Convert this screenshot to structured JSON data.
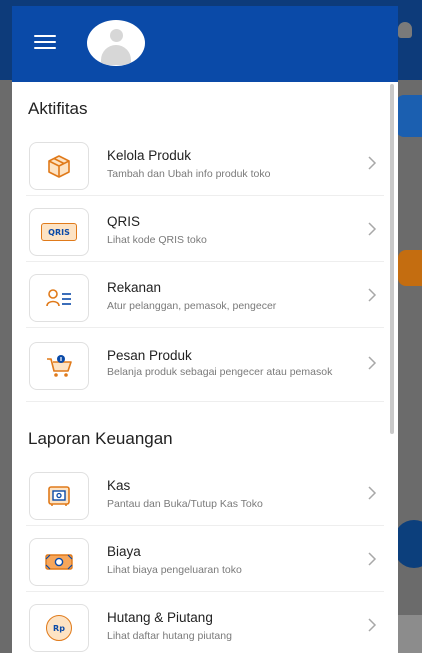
{
  "colors": {
    "header_bg": "#0a4aa8",
    "accent_orange": "#e07a1a",
    "text_primary": "#222222",
    "text_secondary": "#7a7a7a"
  },
  "header": {
    "menu_icon": "hamburger-menu-icon",
    "avatar": "user-avatar"
  },
  "sections": [
    {
      "title": "Aktifitas",
      "items": [
        {
          "title": "Kelola Produk",
          "subtitle": "Tambah dan Ubah info produk toko",
          "icon": "box-icon"
        },
        {
          "title": "QRIS",
          "subtitle": "Lihat kode QRIS toko",
          "icon": "qris-icon",
          "icon_text": "QRIS"
        },
        {
          "title": "Rekanan",
          "subtitle": "Atur pelanggan, pemasok, pengecer",
          "icon": "contacts-icon"
        },
        {
          "title": "Pesan Produk",
          "subtitle": "Belanja produk sebagai pengecer atau pemasok",
          "icon": "cart-icon"
        }
      ]
    },
    {
      "title": "Laporan Keuangan",
      "items": [
        {
          "title": "Kas",
          "subtitle": "Pantau dan Buka/Tutup Kas Toko",
          "icon": "cash-register-icon"
        },
        {
          "title": "Biaya",
          "subtitle": "Lihat biaya pengeluaran toko",
          "icon": "banknote-icon"
        },
        {
          "title": "Hutang & Piutang",
          "subtitle": "Lihat daftar hutang piutang",
          "icon": "rupiah-coin-icon",
          "icon_text": "Rp"
        }
      ]
    }
  ]
}
